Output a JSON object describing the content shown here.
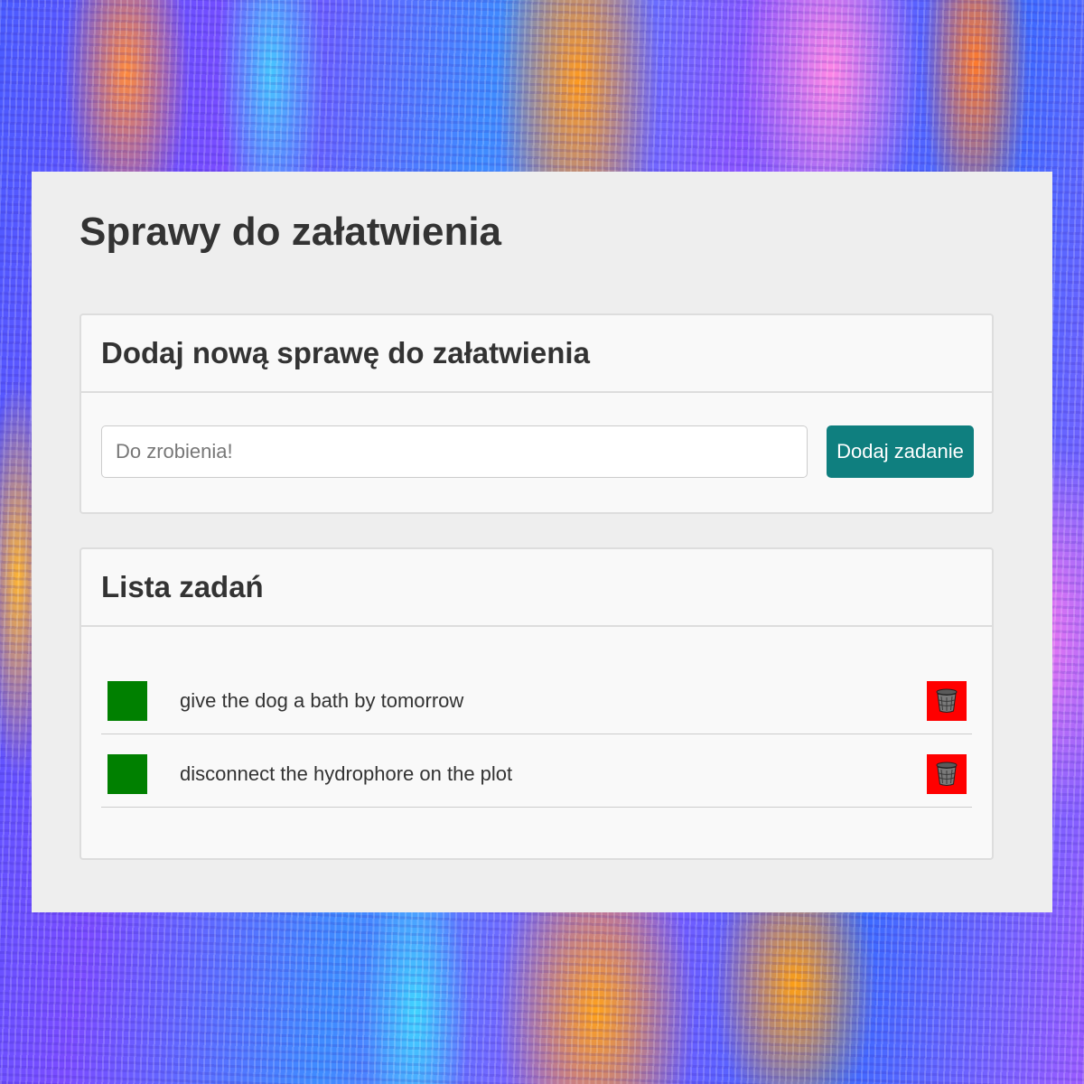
{
  "app": {
    "title": "Sprawy do załatwienia"
  },
  "add_card": {
    "heading": "Dodaj nową sprawę do załatwienia",
    "input_placeholder": "Do zrobienia!",
    "input_value": "",
    "button_label": "Dodaj zadanie"
  },
  "list_card": {
    "heading": "Lista zadań",
    "items": [
      {
        "text": "give the dog a bath by tomorrow",
        "check_icon": "green-square-checkbox",
        "delete_icon": "trash-can-icon"
      },
      {
        "text": "disconnect the hydrophore on the plot",
        "check_icon": "green-square-checkbox",
        "delete_icon": "trash-can-icon"
      }
    ]
  },
  "colors": {
    "accent_button": "#0f7f7f",
    "checkbox": "#008000",
    "delete": "#ff0000"
  }
}
